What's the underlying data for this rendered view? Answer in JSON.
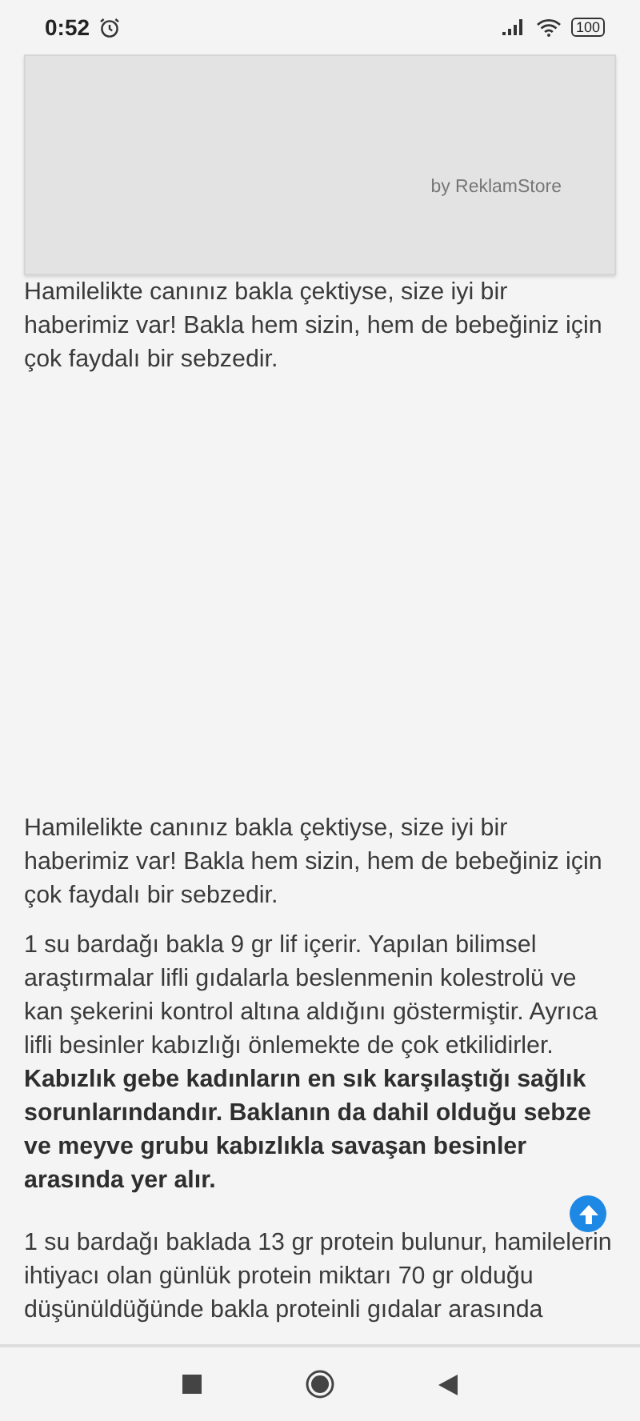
{
  "status_bar": {
    "time": "0:52",
    "battery": "100"
  },
  "ad": {
    "label": "by ReklamStore"
  },
  "paragraphs": [
    {
      "text": "Hamilelikte canınız bakla çektiyse, size iyi bir haberimiz var! Bakla hem sizin, hem de bebeğiniz için çok faydalı bir sebzedir."
    },
    {
      "text": "Hamilelikte canınız bakla çektiyse, size iyi bir haberimiz var! Bakla hem sizin, hem de bebeğiniz için çok faydalı bir sebzedir."
    },
    {
      "text": "1 su bardağı bakla 9 gr lif içerir. Yapılan bilimsel araştırmalar lifli gıdalarla beslenmenin kolestrolü ve kan şekerini kontrol altına aldığını göstermiştir. Ayrıca lifli besinler kabızlığı önlemekte de çok etkilidirler. **Kabızlık gebe kadınların en sık karşılaştığı sağlık sorunlarındandır. Baklanın da dahil olduğu sebze ve meyve grubu kabızlıkla savaşan besinler arasında yer alır.**"
    },
    {
      "text": "1 su bardağı baklada 13 gr protein bulunur, hamilelerin ihtiyacı olan günlük protein miktarı 70 gr olduğu düşünüldüğünde bakla proteinli gıdalar arasında"
    }
  ]
}
